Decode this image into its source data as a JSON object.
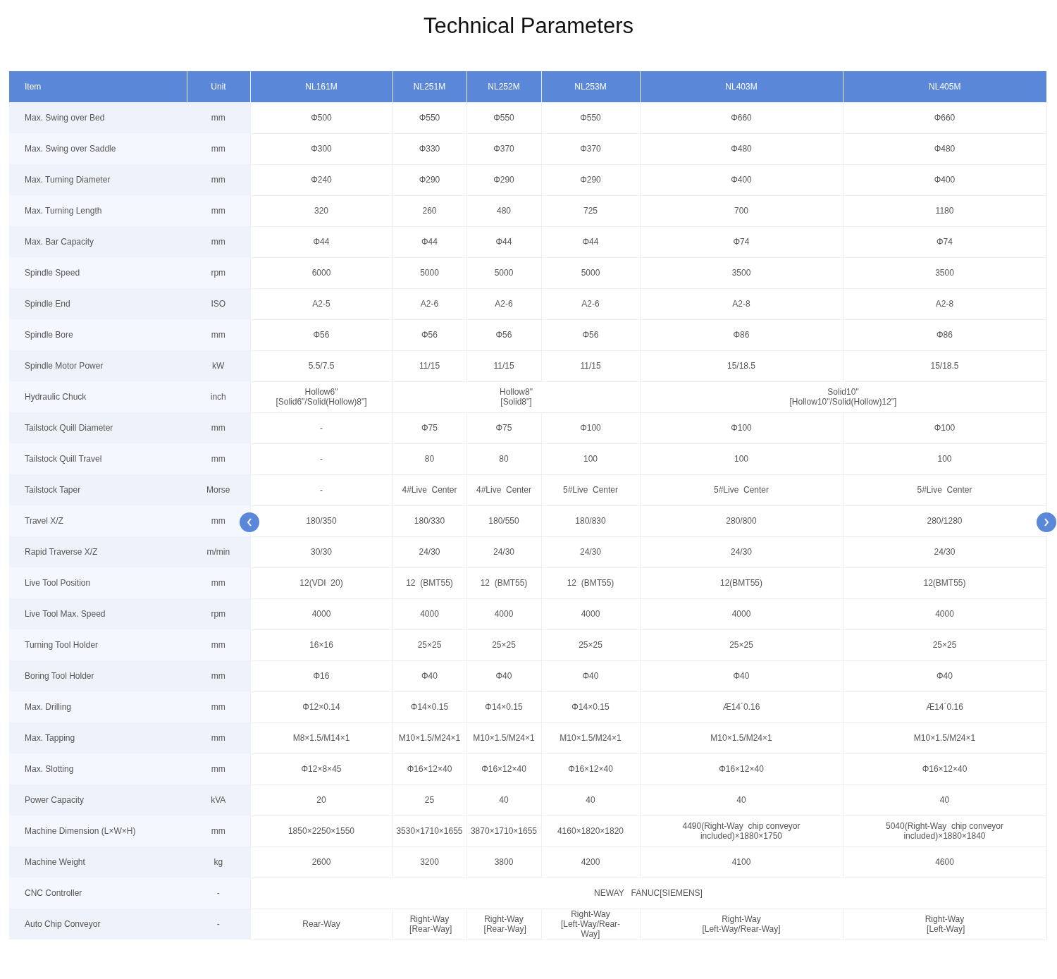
{
  "title": "Technical Parameters",
  "columns": [
    "Item",
    "Unit",
    "NL161M",
    "NL251M",
    "NL252M",
    "NL253M",
    "NL403M",
    "NL405M"
  ],
  "rows": [
    {
      "item": "Max. Swing over Bed",
      "unit": "mm",
      "cells": [
        {
          "text": "Φ500"
        },
        {
          "text": "Φ550"
        },
        {
          "text": "Φ550"
        },
        {
          "text": "Φ550"
        },
        {
          "text": "Φ660"
        },
        {
          "text": "Φ660"
        }
      ]
    },
    {
      "item": "Max. Swing over Saddle",
      "unit": "mm",
      "cells": [
        {
          "text": "Φ300"
        },
        {
          "text": "Φ330"
        },
        {
          "text": "Φ370"
        },
        {
          "text": "Φ370"
        },
        {
          "text": "Φ480"
        },
        {
          "text": "Φ480"
        }
      ]
    },
    {
      "item": "Max. Turning Diameter",
      "unit": "mm",
      "cells": [
        {
          "text": "Φ240"
        },
        {
          "text": "Φ290"
        },
        {
          "text": "Φ290"
        },
        {
          "text": "Φ290"
        },
        {
          "text": "Φ400"
        },
        {
          "text": "Φ400"
        }
      ]
    },
    {
      "item": "Max. Turning Length",
      "unit": "mm",
      "cells": [
        {
          "text": "320"
        },
        {
          "text": "260"
        },
        {
          "text": "480"
        },
        {
          "text": "725"
        },
        {
          "text": "700"
        },
        {
          "text": "1180"
        }
      ]
    },
    {
      "item": "Max. Bar Capacity",
      "unit": "mm",
      "cells": [
        {
          "text": "Φ44"
        },
        {
          "text": "Φ44"
        },
        {
          "text": "Φ44"
        },
        {
          "text": "Φ44"
        },
        {
          "text": "Φ74"
        },
        {
          "text": "Φ74"
        }
      ]
    },
    {
      "item": "Spindle Speed",
      "unit": "rpm",
      "cells": [
        {
          "text": "6000"
        },
        {
          "text": "5000"
        },
        {
          "text": "5000"
        },
        {
          "text": "5000"
        },
        {
          "text": "3500"
        },
        {
          "text": "3500"
        }
      ]
    },
    {
      "item": "Spindle End",
      "unit": "ISO",
      "cells": [
        {
          "text": "A2-5"
        },
        {
          "text": "A2-6"
        },
        {
          "text": "A2-6"
        },
        {
          "text": "A2-6"
        },
        {
          "text": "A2-8"
        },
        {
          "text": "A2-8"
        }
      ]
    },
    {
      "item": "Spindle Bore",
      "unit": "mm",
      "cells": [
        {
          "text": "Φ56"
        },
        {
          "text": "Φ56"
        },
        {
          "text": "Φ56"
        },
        {
          "text": "Φ56"
        },
        {
          "text": "Φ86"
        },
        {
          "text": "Φ86"
        }
      ]
    },
    {
      "item": "Spindle Motor Power",
      "unit": "kW",
      "cells": [
        {
          "text": "5.5/7.5"
        },
        {
          "text": "11/15"
        },
        {
          "text": "11/15"
        },
        {
          "text": "11/15"
        },
        {
          "text": "15/18.5"
        },
        {
          "text": "15/18.5"
        }
      ]
    },
    {
      "item": "Hydraulic Chuck",
      "unit": "inch",
      "cells": [
        {
          "text": "Hollow6\"\n[Solid6\"/Solid(Hollow)8\"]"
        },
        {
          "text": "Hollow8\"\n[Solid8\"]"
        },
        {
          "kind": "merged"
        },
        {
          "kind": "merged"
        },
        {
          "text": "Solid10\"\n[Hollow10\"/Solid(Hollow)12\"]"
        },
        {
          "kind": "merged"
        }
      ]
    },
    {
      "item": "Tailstock Quill Diameter",
      "unit": "mm",
      "cells": [
        {
          "text": "-"
        },
        {
          "text": "Φ75"
        },
        {
          "text": "Φ75"
        },
        {
          "text": "Φ100"
        },
        {
          "text": "Φ100"
        },
        {
          "text": "Φ100"
        }
      ]
    },
    {
      "item": "Tailstock Quill Travel",
      "unit": "mm",
      "cells": [
        {
          "text": "-"
        },
        {
          "text": "80"
        },
        {
          "text": "80"
        },
        {
          "text": "100"
        },
        {
          "text": "100"
        },
        {
          "text": "100"
        }
      ]
    },
    {
      "item": "Tailstock Taper",
      "unit": "Morse",
      "cells": [
        {
          "text": "-"
        },
        {
          "text": "4#Live  Center"
        },
        {
          "text": "4#Live  Center"
        },
        {
          "text": "5#Live  Center"
        },
        {
          "text": "5#Live  Center"
        },
        {
          "text": "5#Live  Center"
        }
      ]
    },
    {
      "item": "Travel X/Z",
      "unit": "mm",
      "cells": [
        {
          "text": "180/350"
        },
        {
          "text": "180/330"
        },
        {
          "text": "180/550"
        },
        {
          "text": "180/830"
        },
        {
          "text": "280/800"
        },
        {
          "text": "280/1280"
        }
      ]
    },
    {
      "item": "Rapid Traverse X/Z",
      "unit": "m/min",
      "cells": [
        {
          "text": "30/30"
        },
        {
          "text": "24/30"
        },
        {
          "text": "24/30"
        },
        {
          "text": "24/30"
        },
        {
          "text": "24/30"
        },
        {
          "text": "24/30"
        }
      ]
    },
    {
      "item": "Live Tool Position",
      "unit": "mm",
      "cells": [
        {
          "text": "12(VDI  20)"
        },
        {
          "text": "12  (BMT55)"
        },
        {
          "text": "12  (BMT55)"
        },
        {
          "text": "12  (BMT55)"
        },
        {
          "text": "12(BMT55)"
        },
        {
          "text": "12(BMT55)"
        }
      ]
    },
    {
      "item": "Live Tool Max. Speed",
      "unit": "rpm",
      "cells": [
        {
          "text": "4000"
        },
        {
          "text": "4000"
        },
        {
          "text": "4000"
        },
        {
          "text": "4000"
        },
        {
          "text": "4000"
        },
        {
          "text": "4000"
        }
      ]
    },
    {
      "item": "Turning Tool Holder",
      "unit": "mm",
      "cells": [
        {
          "text": "16×16"
        },
        {
          "text": "25×25"
        },
        {
          "text": "25×25"
        },
        {
          "text": "25×25"
        },
        {
          "text": "25×25"
        },
        {
          "text": "25×25"
        }
      ]
    },
    {
      "item": "Boring Tool Holder",
      "unit": "mm",
      "cells": [
        {
          "text": "Φ16"
        },
        {
          "text": "Φ40"
        },
        {
          "text": "Φ40"
        },
        {
          "text": "Φ40"
        },
        {
          "text": "Φ40"
        },
        {
          "text": "Φ40"
        }
      ]
    },
    {
      "item": "Max. Drilling",
      "unit": "mm",
      "cells": [
        {
          "text": "Φ12×0.14"
        },
        {
          "text": "Φ14×0.15"
        },
        {
          "text": "Φ14×0.15"
        },
        {
          "text": "Φ14×0.15"
        },
        {
          "text": "Æ14´0.16"
        },
        {
          "text": "Æ14´0.16"
        }
      ]
    },
    {
      "item": "Max. Tapping",
      "unit": "mm",
      "cells": [
        {
          "text": "M8×1.5/M14×1"
        },
        {
          "text": "M10×1.5/M24×1"
        },
        {
          "text": "M10×1.5/M24×1"
        },
        {
          "text": "M10×1.5/M24×1"
        },
        {
          "text": "M10×1.5/M24×1"
        },
        {
          "text": "M10×1.5/M24×1"
        }
      ]
    },
    {
      "item": "Max. Slotting",
      "unit": "mm",
      "cells": [
        {
          "text": "Φ12×8×45"
        },
        {
          "text": "Φ16×12×40"
        },
        {
          "text": "Φ16×12×40"
        },
        {
          "text": "Φ16×12×40"
        },
        {
          "text": "Φ16×12×40"
        },
        {
          "text": "Φ16×12×40"
        }
      ]
    },
    {
      "item": "Power Capacity",
      "unit": "kVA",
      "cells": [
        {
          "text": "20"
        },
        {
          "text": "25"
        },
        {
          "text": "40"
        },
        {
          "text": "40"
        },
        {
          "text": "40"
        },
        {
          "text": "40"
        }
      ]
    },
    {
      "item": "Machine Dimension (L×W×H)",
      "unit": "mm",
      "cells": [
        {
          "text": "1850×2250×1550"
        },
        {
          "text": "3530×1710×1655"
        },
        {
          "text": "3870×1710×1655"
        },
        {
          "text": "4160×1820×1820"
        },
        {
          "text": "4490(Right-Way  chip conveyor\nincluded)×1880×1750"
        },
        {
          "text": "5040(Right-Way  chip conveyor\nincluded)×1880×1840"
        }
      ]
    },
    {
      "item": "Machine Weight",
      "unit": "kg",
      "cells": [
        {
          "text": "2600"
        },
        {
          "text": "3200"
        },
        {
          "text": "3800"
        },
        {
          "text": "4200"
        },
        {
          "text": "4100"
        },
        {
          "text": "4600"
        }
      ]
    },
    {
      "item": "CNC Controller",
      "unit": "-",
      "cells": [
        {
          "text": "NEWAY   FANUC[SIEMENS]"
        },
        {
          "kind": "merged"
        },
        {
          "kind": "merged"
        },
        {
          "kind": "merged"
        },
        {
          "kind": "merged"
        },
        {
          "kind": "merged"
        }
      ]
    },
    {
      "item": "Auto Chip Conveyor",
      "unit": "-",
      "cells": [
        {
          "text": "Rear-Way"
        },
        {
          "text": "Right-Way\n [Rear-Way]"
        },
        {
          "text": "Right-Way\n [Rear-Way]"
        },
        {
          "text": "Right-Way\n[Left-Way/Rear-\nWay]"
        },
        {
          "text": "Right-Way\n[Left-Way/Rear-Way]"
        },
        {
          "text": "Right-Way\n [Left-Way]"
        }
      ]
    }
  ]
}
